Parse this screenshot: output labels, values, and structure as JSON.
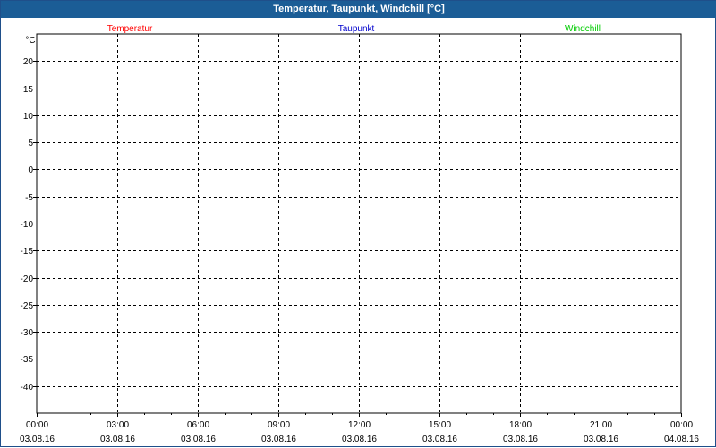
{
  "window": {
    "title": "Temperatur, Taupunkt, Windchill [°C]"
  },
  "chart_data": {
    "type": "line",
    "title": "Temperatur, Taupunkt, Windchill [°C]",
    "ylabel": "°C",
    "xlabel": "",
    "ylim": [
      -45,
      25
    ],
    "yticks": [
      20,
      15,
      10,
      5,
      0,
      -5,
      -10,
      -15,
      -20,
      -25,
      -30,
      -35,
      -40
    ],
    "xticks": [
      {
        "time": "00:00",
        "date": "03.08.16"
      },
      {
        "time": "03:00",
        "date": "03.08.16"
      },
      {
        "time": "06:00",
        "date": "03.08.16"
      },
      {
        "time": "09:00",
        "date": "03.08.16"
      },
      {
        "time": "12:00",
        "date": "03.08.16"
      },
      {
        "time": "15:00",
        "date": "03.08.16"
      },
      {
        "time": "18:00",
        "date": "03.08.16"
      },
      {
        "time": "21:00",
        "date": "03.08.16"
      },
      {
        "time": "00:00",
        "date": "04.08.16"
      }
    ],
    "grid": true,
    "legend_placement": "top",
    "series": [
      {
        "name": "Temperatur",
        "color": "#ff0000",
        "values": []
      },
      {
        "name": "Taupunkt",
        "color": "#0000cc",
        "values": []
      },
      {
        "name": "Windchill",
        "color": "#00cc00",
        "values": []
      }
    ]
  }
}
